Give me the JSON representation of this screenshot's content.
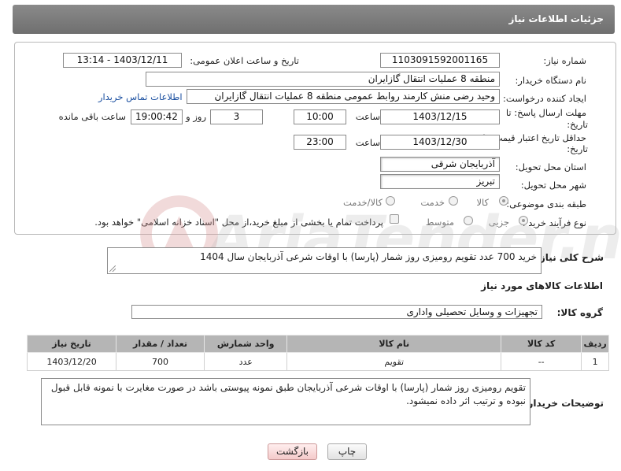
{
  "header": {
    "title": "جزئیات اطلاعات نیاز"
  },
  "form": {
    "need_number_label": "شماره نیاز:",
    "need_number": "1103091592001165",
    "announce_label": "تاریخ و ساعت اعلان عمومی:",
    "announce_value": "1403/12/11 - 13:14",
    "buyer_org_label": "نام دستگاه خریدار:",
    "buyer_org": "منطقه 8 عملیات انتقال گازایران",
    "requester_label": "ایجاد کننده درخواست:",
    "requester": "وحید رضی منش کارمند روابط عمومی منطقه 8 عملیات انتقال گازایران",
    "buyer_contact_link": "اطلاعات تماس خریدار",
    "deadline_label_1": "مهلت ارسال پاسخ: تا",
    "deadline_label_2": "تاریخ:",
    "deadline_date": "1403/12/15",
    "time_label": "ساعت",
    "deadline_time": "10:00",
    "days_value": "3",
    "days_label": "روز و",
    "remaining_time": "19:00:42",
    "remaining_label": "ساعت باقی مانده",
    "validity_label_1": "حداقل تاریخ اعتبار قیمت: تا",
    "validity_label_2": "تاریخ:",
    "validity_date": "1403/12/30",
    "validity_time": "23:00",
    "province_label": "استان محل تحویل:",
    "province": "آذربایجان شرقی",
    "city_label": "شهر محل تحویل:",
    "city": "تبریز",
    "category_label": "طبقه بندی موضوعی:",
    "category_options": [
      "کالا",
      "خدمت",
      "کالا/خدمت"
    ],
    "category_selected": "کالا",
    "process_label": "نوع فرآیند خرید :",
    "process_options": [
      "جزیی",
      "متوسط"
    ],
    "process_selected": "جزیی",
    "payment_note": "پرداخت تمام یا بخشی از مبلغ خرید،از محل \"اسناد خزانه اسلامی\" خواهد بود."
  },
  "summary": {
    "label": "شرح کلی نیاز:",
    "text": "خرید 700 عدد تقویم رومیزی روز شمار (پارسا) با اوقات شرعی آذربایجان سال 1404"
  },
  "goods_section": {
    "title": "اطلاعات کالاهای مورد نیاز",
    "group_label": "گروه کالا:",
    "group_value": "تجهیزات و وسایل تحصیلی واداری"
  },
  "table": {
    "headers": [
      "ردیف",
      "کد کالا",
      "نام کالا",
      "واحد شمارش",
      "تعداد / مقدار",
      "تاریخ نیاز"
    ],
    "rows": [
      [
        "1",
        "--",
        "تقویم",
        "عدد",
        "700",
        "1403/12/20"
      ]
    ]
  },
  "buyer_notes": {
    "label": "توضیحات خریدار:",
    "text": "تقویم رومیزی روز شمار (پارسا) با اوقات شرعی آذربایجان طبق نمونه پیوستی باشد در صورت مغایرت با نمونه قابل قبول نبوده و ترتیب اثر داده نمیشود."
  },
  "buttons": {
    "print": "چاپ",
    "back": "بازگشت"
  },
  "watermark": {
    "text": "AriaTender.net"
  },
  "colors": {
    "header_bg": "#7a7a7a",
    "link": "#1a4fa0",
    "table_header": "#b5b5b5",
    "back_button": "#f4caca"
  }
}
